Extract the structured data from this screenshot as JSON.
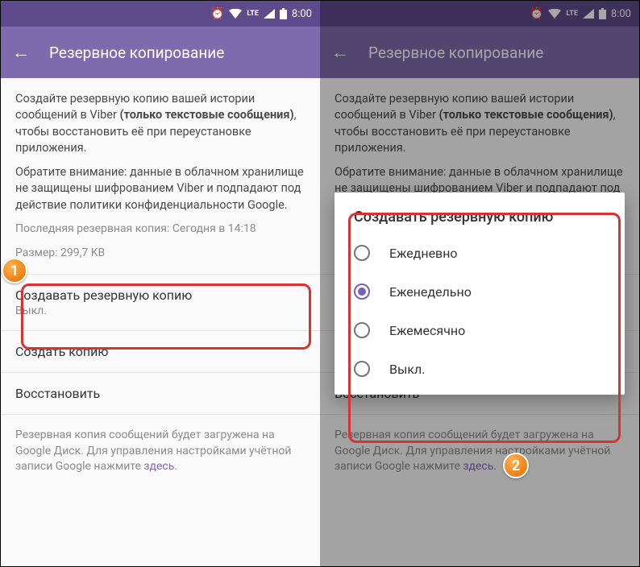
{
  "statusbar": {
    "time": "8:00",
    "lte": "LTE"
  },
  "appbar": {
    "title": "Резервное копирование"
  },
  "desc": {
    "part1": "Создайте резервную копию вашей истории сообщений в Viber ",
    "bold": "(только текстовые сообщения)",
    "part2": ", чтобы восстановить её при переустановке приложения.",
    "part3": "Обратите внимание: данные в облачном хранилище не защищены шифрованием Viber и подпадают под действие политики конфиденциальности Google."
  },
  "meta": {
    "last": "Последняя резервная копия: Сегодня в 14:18",
    "size": "Размер: 299,7 KB"
  },
  "items": {
    "create_schedule": {
      "label": "Создавать резервную копию",
      "sub": "Выкл."
    },
    "create_now": {
      "label": "Создать копию"
    },
    "restore": {
      "label": "Восстановить"
    }
  },
  "footer": {
    "text": "Резервная копия сообщений будет загружена на Google Диск. Для управления настройками учётной записи Google нажмите ",
    "link": "здесь",
    "dot": "."
  },
  "dialog": {
    "title": "Создавать резервную копию",
    "options": [
      "Ежедневно",
      "Еженедельно",
      "Ежемесячно",
      "Выкл."
    ],
    "selected": 1
  },
  "badges": {
    "b1": "1",
    "b2": "2"
  }
}
